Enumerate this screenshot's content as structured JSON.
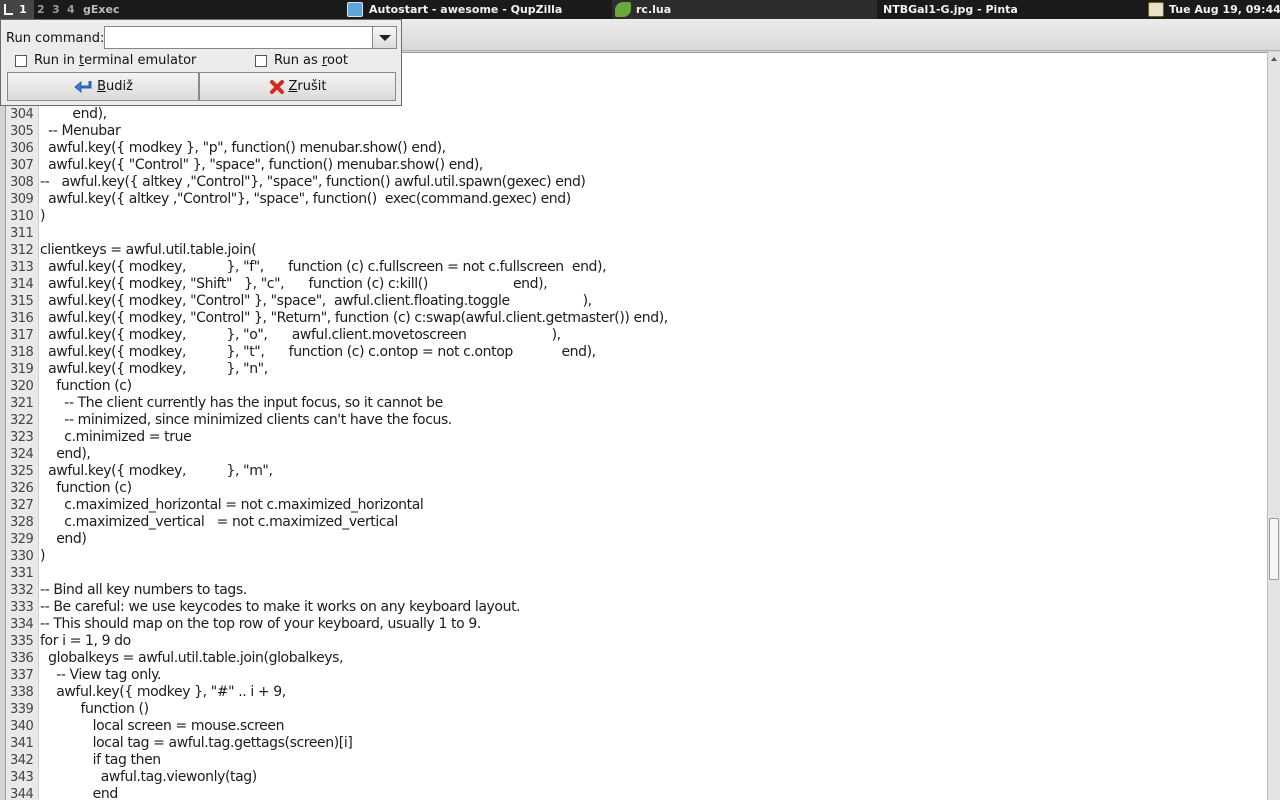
{
  "topbar": {
    "tags": [
      "1",
      "2",
      "3",
      "4"
    ],
    "prompt_label": "gExec",
    "tasks": [
      {
        "title": "Autostart - awesome - QupZilla",
        "icon": "qupzilla-icon"
      },
      {
        "title": "rc.lua",
        "icon": "editor-leaf-icon"
      },
      {
        "title": "NTBGal1-G.jpg - Pinta",
        "icon": "pinta-icon"
      }
    ],
    "clock": "Tue Aug 19, 09:44",
    "colors": {
      "panel_bg": "#1a1a1a",
      "focused": "#2d2d2d"
    }
  },
  "gexec": {
    "run_command_label": "Run command:",
    "command_value": "",
    "terminal_label_pre": "Run in ",
    "terminal_label_ul": "t",
    "terminal_label_post": "erminal emulator",
    "root_label_pre": "Run as ",
    "root_label_ul": "r",
    "root_label_post": "oot",
    "ok_ul": "B",
    "ok_rest": "udiž",
    "cancel_ul": "Z",
    "cancel_rest": "rušit",
    "terminal_checked": false,
    "root_checked": false
  },
  "editor": {
    "lines": [
      {
        "n": "304",
        "t": "        end),"
      },
      {
        "n": "305",
        "t": "  -- Menubar"
      },
      {
        "n": "306",
        "t": "  awful.key({ modkey }, \"p\", function() menubar.show() end),"
      },
      {
        "n": "307",
        "t": "  awful.key({ \"Control\" }, \"space\", function() menubar.show() end),"
      },
      {
        "n": "308",
        "t": "--   awful.key({ altkey ,\"Control\"}, \"space\", function() awful.util.spawn(gexec) end)"
      },
      {
        "n": "309",
        "t": "  awful.key({ altkey ,\"Control\"}, \"space\", function()  exec(command.gexec) end)"
      },
      {
        "n": "310",
        "t": ")"
      },
      {
        "n": "311",
        "t": ""
      },
      {
        "n": "312",
        "t": "clientkeys = awful.util.table.join("
      },
      {
        "n": "313",
        "t": "  awful.key({ modkey,          }, \"f\",      function (c) c.fullscreen = not c.fullscreen  end),"
      },
      {
        "n": "314",
        "t": "  awful.key({ modkey, \"Shift\"   }, \"c\",      function (c) c:kill()                     end),"
      },
      {
        "n": "315",
        "t": "  awful.key({ modkey, \"Control\" }, \"space\",  awful.client.floating.toggle                  ),"
      },
      {
        "n": "316",
        "t": "  awful.key({ modkey, \"Control\" }, \"Return\", function (c) c:swap(awful.client.getmaster()) end),"
      },
      {
        "n": "317",
        "t": "  awful.key({ modkey,          }, \"o\",      awful.client.movetoscreen                     ),"
      },
      {
        "n": "318",
        "t": "  awful.key({ modkey,          }, \"t\",      function (c) c.ontop = not c.ontop            end),"
      },
      {
        "n": "319",
        "t": "  awful.key({ modkey,          }, \"n\","
      },
      {
        "n": "320",
        "t": "    function (c)"
      },
      {
        "n": "321",
        "t": "      -- The client currently has the input focus, so it cannot be"
      },
      {
        "n": "322",
        "t": "      -- minimized, since minimized clients can't have the focus."
      },
      {
        "n": "323",
        "t": "      c.minimized = true"
      },
      {
        "n": "324",
        "t": "    end),"
      },
      {
        "n": "325",
        "t": "  awful.key({ modkey,          }, \"m\","
      },
      {
        "n": "326",
        "t": "    function (c)"
      },
      {
        "n": "327",
        "t": "      c.maximized_horizontal = not c.maximized_horizontal"
      },
      {
        "n": "328",
        "t": "      c.maximized_vertical   = not c.maximized_vertical"
      },
      {
        "n": "329",
        "t": "    end)"
      },
      {
        "n": "330",
        "t": ")"
      },
      {
        "n": "331",
        "t": ""
      },
      {
        "n": "332",
        "t": "-- Bind all key numbers to tags."
      },
      {
        "n": "333",
        "t": "-- Be careful: we use keycodes to make it works on any keyboard layout."
      },
      {
        "n": "334",
        "t": "-- This should map on the top row of your keyboard, usually 1 to 9."
      },
      {
        "n": "335",
        "t": "for i = 1, 9 do"
      },
      {
        "n": "336",
        "t": "  globalkeys = awful.util.table.join(globalkeys,"
      },
      {
        "n": "337",
        "t": "    -- View tag only."
      },
      {
        "n": "338",
        "t": "    awful.key({ modkey }, \"#\" .. i + 9,"
      },
      {
        "n": "339",
        "t": "          function ()"
      },
      {
        "n": "340",
        "t": "             local screen = mouse.screen"
      },
      {
        "n": "341",
        "t": "             local tag = awful.tag.gettags(screen)[i]"
      },
      {
        "n": "342",
        "t": "             if tag then"
      },
      {
        "n": "343",
        "t": "               awful.tag.viewonly(tag)"
      },
      {
        "n": "344",
        "t": "             end"
      }
    ]
  }
}
